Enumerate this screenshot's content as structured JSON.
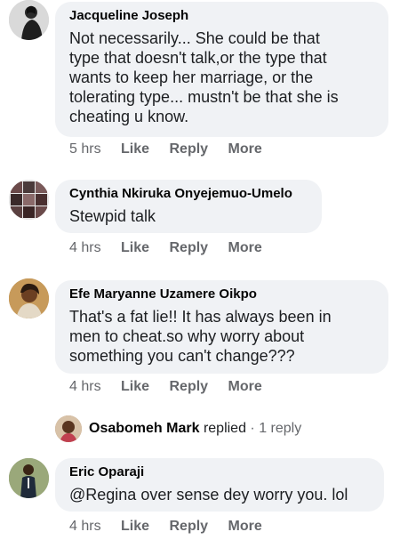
{
  "comments": [
    {
      "author": "Jacqueline Joseph",
      "text": "Not necessarily... She could be that\ntype that doesn't talk,or the type that\nwants to keep her marriage, or the\ntolerating type... mustn't be that she is\ncheating u know.",
      "time": "5 hrs",
      "like": "Like",
      "reply": "Reply",
      "more": "More"
    },
    {
      "author": "Cynthia Nkiruka Onyejemuo-Umelo",
      "text": "Stewpid talk",
      "time": "4 hrs",
      "like": "Like",
      "reply": "Reply",
      "more": "More"
    },
    {
      "author": "Efe Maryanne Uzamere Oikpo",
      "text": "That's a fat lie!! It has always been in\nmen to cheat.so why worry about\nsomething you can't change???",
      "time": "4 hrs",
      "like": "Like",
      "reply": "Reply",
      "more": "More"
    },
    {
      "author": "Eric Oparaji",
      "text": "@Regina over sense dey worry you. lol",
      "time": "4 hrs",
      "like": "Like",
      "reply": "Reply",
      "more": "More"
    }
  ],
  "replies": {
    "name": "Osabomeh Mark",
    "word": "replied",
    "separator": " · ",
    "count": "1 reply"
  },
  "colors": {
    "bubble": "#f0f2f5",
    "meta": "#65676b",
    "name": "#050505"
  }
}
